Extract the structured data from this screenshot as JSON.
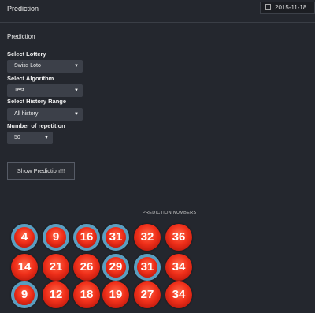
{
  "header": {
    "title": "Prediction",
    "date": "2015-11-18"
  },
  "form": {
    "section_title": "Prediction",
    "lottery": {
      "label": "Select Lottery",
      "value": "Swiss Loto"
    },
    "algorithm": {
      "label": "Select Algorithm",
      "value": "Test"
    },
    "history": {
      "label": "Select History Range",
      "value": "All history"
    },
    "repetition": {
      "label": "Number of repetition",
      "value": "50"
    },
    "button": "Show Prediction!!!"
  },
  "predictions": {
    "title": "PREDICTION NUMBERS",
    "highlight_color": "#5a9ec0",
    "ball_color": "#f0301a",
    "rows": [
      [
        {
          "n": "4",
          "hl": true
        },
        {
          "n": "9",
          "hl": true
        },
        {
          "n": "16",
          "hl": true
        },
        {
          "n": "31",
          "hl": true
        },
        {
          "n": "32",
          "hl": false
        },
        {
          "n": "36",
          "hl": false
        }
      ],
      [
        {
          "n": "14",
          "hl": false
        },
        {
          "n": "21",
          "hl": false
        },
        {
          "n": "26",
          "hl": false
        },
        {
          "n": "29",
          "hl": true
        },
        {
          "n": "31",
          "hl": true
        },
        {
          "n": "34",
          "hl": false
        }
      ],
      [
        {
          "n": "9",
          "hl": true
        },
        {
          "n": "12",
          "hl": false
        },
        {
          "n": "18",
          "hl": false
        },
        {
          "n": "19",
          "hl": false
        },
        {
          "n": "27",
          "hl": false
        },
        {
          "n": "34",
          "hl": false
        }
      ]
    ]
  }
}
